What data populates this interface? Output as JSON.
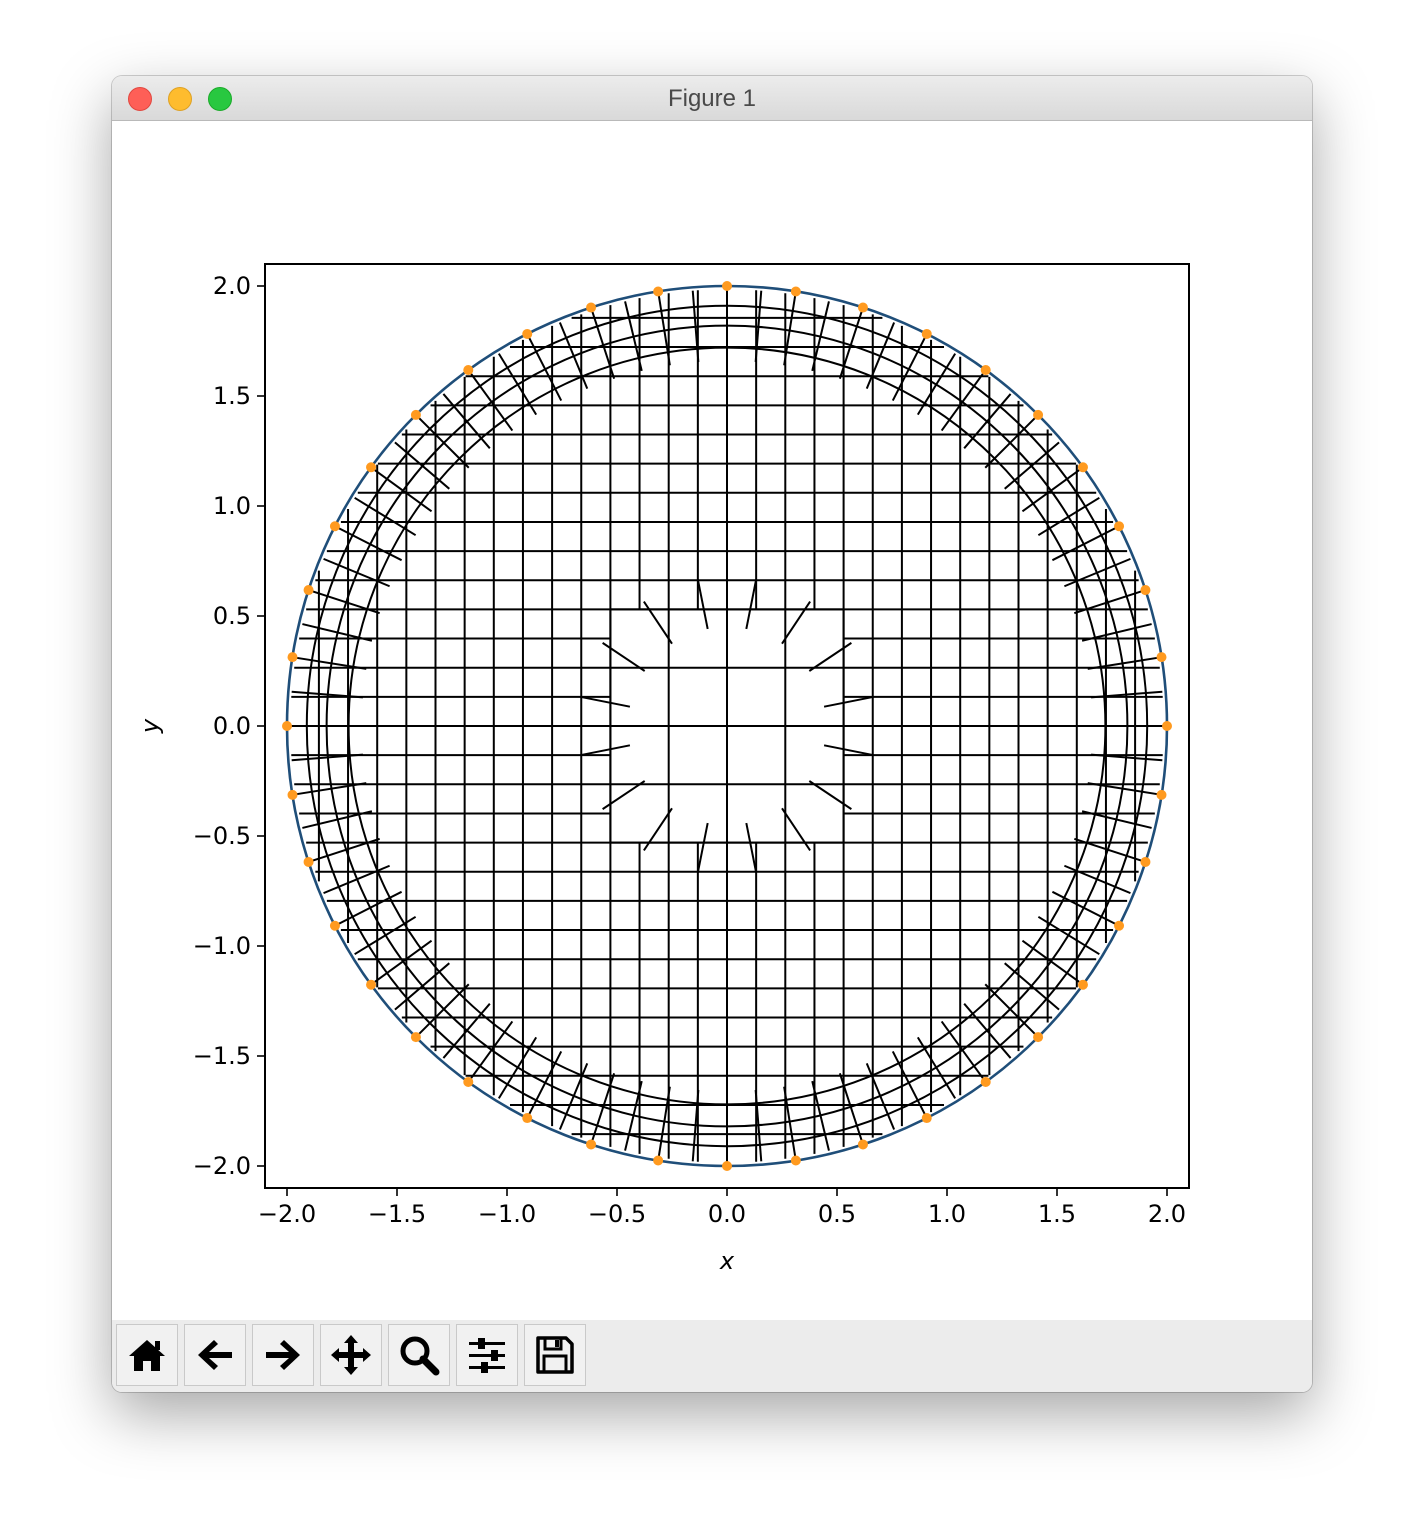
{
  "window": {
    "title": "Figure 1"
  },
  "toolbar": {
    "buttons": [
      {
        "name": "home-button",
        "icon": "home-icon"
      },
      {
        "name": "back-button",
        "icon": "arrow-left-icon"
      },
      {
        "name": "forward-button",
        "icon": "arrow-right-icon"
      },
      {
        "name": "pan-button",
        "icon": "move-icon"
      },
      {
        "name": "zoom-button",
        "icon": "magnifier-icon"
      },
      {
        "name": "configure-subplots-button",
        "icon": "sliders-icon"
      },
      {
        "name": "save-button",
        "icon": "floppy-disk-icon"
      }
    ]
  },
  "chart_data": {
    "type": "scatter",
    "title": "",
    "xlabel": "x",
    "ylabel": "y",
    "xlim": [
      -2.1,
      2.1
    ],
    "ylim": [
      -2.1,
      2.1
    ],
    "xticks": [
      "−2.0",
      "−1.5",
      "−1.0",
      "−0.5",
      "0.0",
      "0.5",
      "1.0",
      "1.5",
      "2.0"
    ],
    "yticks": [
      "2.0",
      "1.5",
      "1.0",
      "0.5",
      "0.0",
      "−0.5",
      "−1.0",
      "−1.5",
      "−2.0"
    ],
    "boundary": {
      "shape": "circle",
      "center": [
        0,
        0
      ],
      "radius": 2.0,
      "color": "#1f4e79"
    },
    "mesh": {
      "type": "quadrilateral",
      "color": "#000000"
    },
    "boundary_points": {
      "color": "#ff9a1f",
      "count": 40,
      "x": [
        2.0,
        1.975,
        1.902,
        1.782,
        1.618,
        1.414,
        1.176,
        0.908,
        0.618,
        0.313,
        0.0,
        -0.313,
        -0.618,
        -0.908,
        -1.176,
        -1.414,
        -1.618,
        -1.782,
        -1.902,
        -1.975,
        -2.0,
        -1.975,
        -1.902,
        -1.782,
        -1.618,
        -1.414,
        -1.176,
        -0.908,
        -0.618,
        -0.313,
        0.0,
        0.313,
        0.618,
        0.908,
        1.176,
        1.414,
        1.618,
        1.782,
        1.902,
        1.975
      ],
      "y": [
        0.0,
        0.313,
        0.618,
        0.908,
        1.176,
        1.414,
        1.618,
        1.782,
        1.902,
        1.975,
        2.0,
        1.975,
        1.902,
        1.782,
        1.618,
        1.414,
        1.176,
        0.908,
        0.618,
        0.313,
        0.0,
        -0.313,
        -0.618,
        -0.908,
        -1.176,
        -1.414,
        -1.618,
        -1.782,
        -1.902,
        -1.975,
        -2.0,
        -1.975,
        -1.902,
        -1.782,
        -1.618,
        -1.414,
        -1.176,
        -0.908,
        -0.618,
        -0.313
      ]
    }
  }
}
